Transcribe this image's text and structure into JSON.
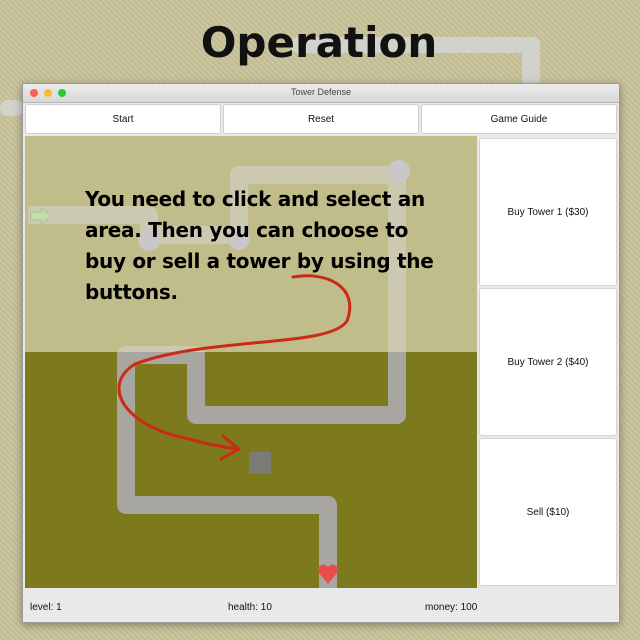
{
  "heading": "Operation",
  "window": {
    "title": "Tower Defense"
  },
  "toolbar": {
    "start": "Start",
    "reset": "Reset",
    "guide": "Game Guide"
  },
  "sidebar": {
    "buy1": "Buy Tower 1 ($30)",
    "buy2": "Buy Tower 2 ($40)",
    "sell": "Sell ($10)"
  },
  "status": {
    "level": "level: 1",
    "health": "health: 10",
    "money": "money: 100"
  },
  "instruction": "You need to click and select an area. Then you can choose to buy or sell a tower by using the buttons.",
  "colors": {
    "grass": "#7d7a1e",
    "path": "#a7a6a1",
    "enemy": "#9e9ef6",
    "start_arrow": "#90ee90",
    "heart": "#e84d4d",
    "arrow": "#cc2a14",
    "selected_cell": "#7b7b77"
  },
  "icons": [
    "start-arrow-icon",
    "heart-icon",
    "enemy-circle-icon"
  ]
}
